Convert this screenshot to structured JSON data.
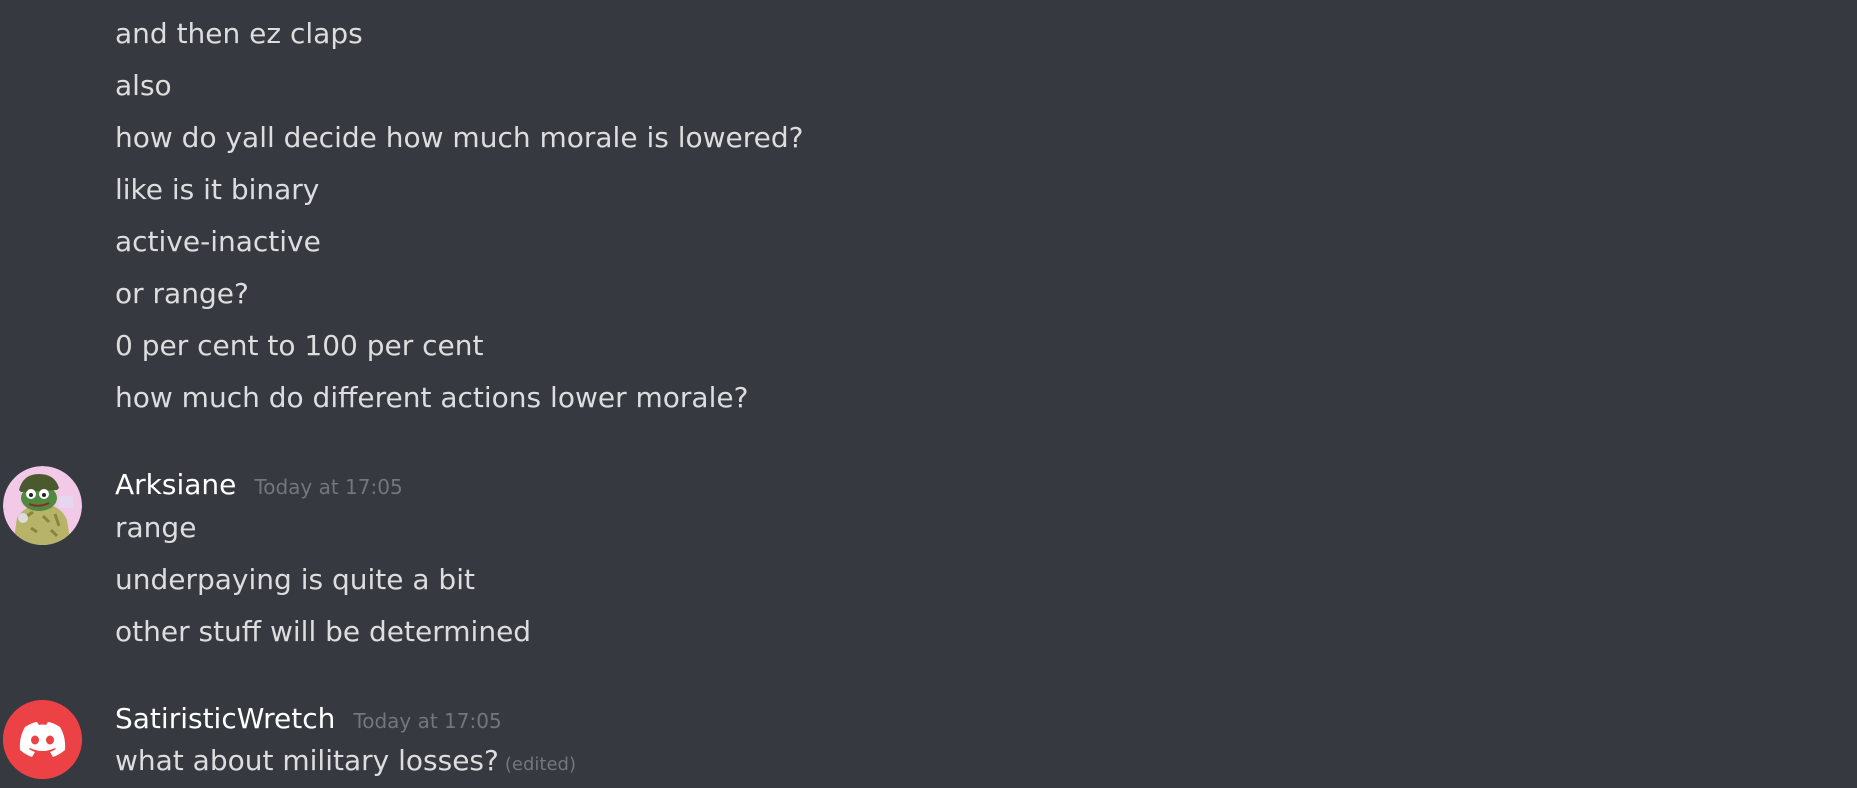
{
  "group1": {
    "messages": [
      "and then ez claps",
      "also",
      "how do yall decide how much morale is lowered?",
      "like is it binary",
      "active-inactive",
      "or range?",
      "0 per cent to 100 per cent",
      "how much do different actions lower morale?"
    ]
  },
  "group2": {
    "username": "Arksiane",
    "timestamp": "Today at 17:05",
    "avatar_icon": "frog-soldier-avatar",
    "messages": [
      "range",
      "underpaying is quite a bit",
      "other stuff will be determined"
    ]
  },
  "group3": {
    "username": "SatiristicWretch",
    "timestamp": "Today at 17:05",
    "avatar_icon": "discord-logo-avatar",
    "avatar_color": "#ed4245",
    "messages": [
      "what about military losses?"
    ],
    "edited_label": "(edited)"
  },
  "colors": {
    "background": "#36393f",
    "message_text": "#dcddde",
    "username": "#ffffff",
    "timestamp": "#72767d"
  }
}
